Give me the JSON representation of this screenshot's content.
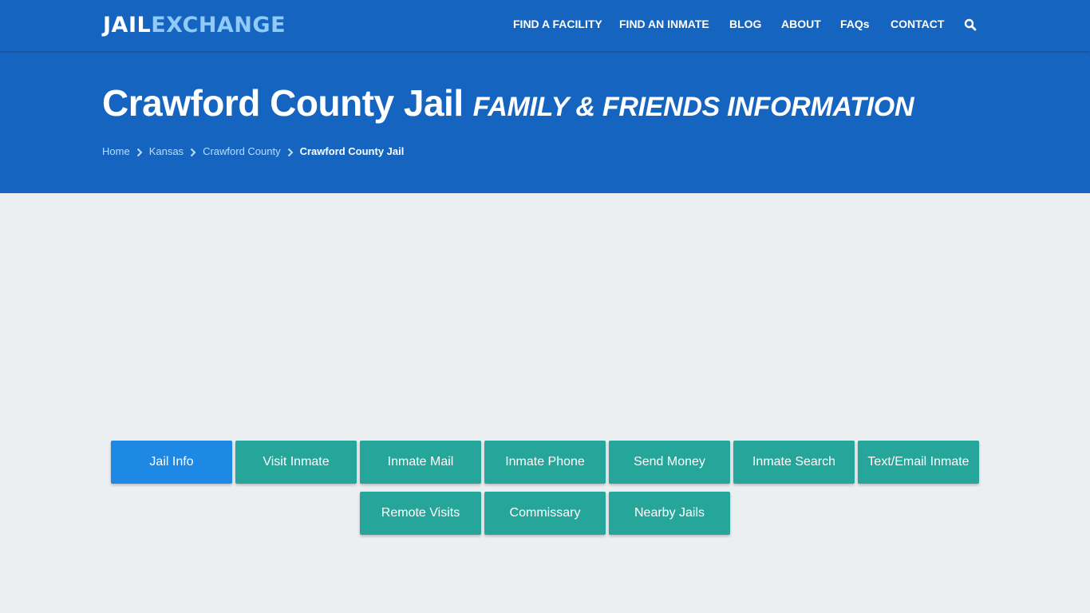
{
  "header": {
    "logo": {
      "part1": "JAIL",
      "part2": "EXCHANGE"
    },
    "nav": [
      {
        "label": "FIND A FACILITY"
      },
      {
        "label": "FIND AN INMATE"
      },
      {
        "label": "BLOG"
      },
      {
        "label": "ABOUT"
      },
      {
        "label": "FAQs"
      },
      {
        "label": "CONTACT"
      }
    ],
    "search_icon": "search-icon"
  },
  "hero": {
    "title": "Crawford County Jail",
    "subtitle": "FAMILY & FRIENDS INFORMATION",
    "breadcrumb": [
      {
        "label": "Home"
      },
      {
        "label": "Kansas"
      },
      {
        "label": "Crawford County"
      },
      {
        "label": "Crawford County Jail"
      }
    ]
  },
  "buttons": [
    {
      "label": "Jail Info",
      "active": true
    },
    {
      "label": "Visit Inmate"
    },
    {
      "label": "Inmate Mail"
    },
    {
      "label": "Inmate Phone"
    },
    {
      "label": "Send Money"
    },
    {
      "label": "Inmate Search"
    },
    {
      "label": "Text/Email Inmate"
    },
    {
      "label": "Remote Visits"
    },
    {
      "label": "Commissary"
    },
    {
      "label": "Nearby Jails"
    }
  ],
  "colors": {
    "primary": "#1565c0",
    "active_button": "#1e88e5",
    "button": "#26a69a",
    "background": "#eceff2",
    "logo_accent": "#90caf9"
  }
}
